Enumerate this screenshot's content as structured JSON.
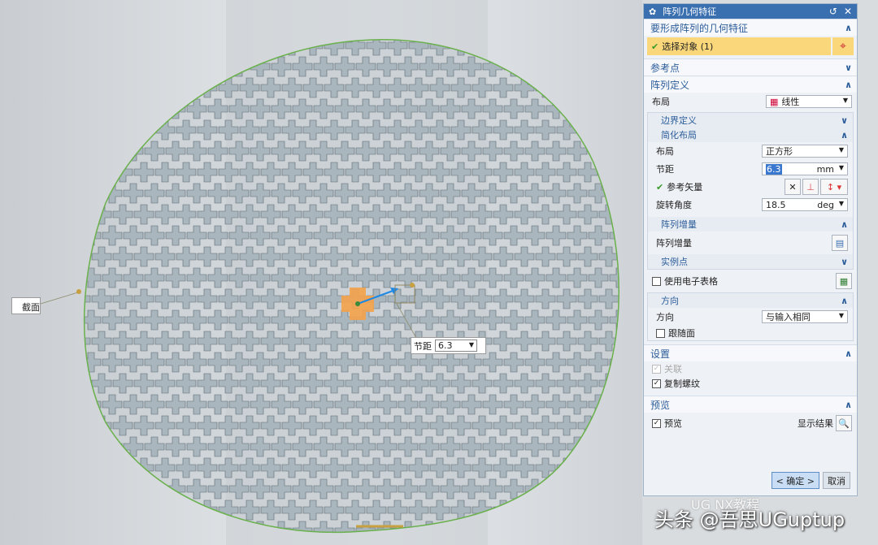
{
  "viewport": {
    "section_label": "截面",
    "pitch_label": "节距",
    "pitch_value": "6.3",
    "colors": {
      "pattern": "#a9b6bd",
      "boundary": "#6ab04c",
      "seed": "#f5a24a",
      "vector": "#1e88e5"
    }
  },
  "dialog": {
    "title": "阵列几何特征",
    "geometry_section": {
      "title": "要形成阵列的几何特征",
      "select_label": "选择对象 (1)"
    },
    "ref_point": {
      "title": "参考点"
    },
    "pattern_def": {
      "title": "阵列定义",
      "layout_label": "布局",
      "layout_value": "线性",
      "boundary": {
        "title": "边界定义"
      },
      "simple": {
        "title": "简化布局",
        "layout_label": "布局",
        "layout_value": "正方形",
        "pitch_label": "节距",
        "pitch_value": "6.3",
        "pitch_unit": "mm",
        "ref_vector_label": "参考矢量",
        "rotation_label": "旋转角度",
        "rotation_value": "18.5",
        "rotation_unit": "deg"
      },
      "increment": {
        "title": "阵列增量",
        "label": "阵列增量"
      },
      "instance": {
        "title": "实例点"
      },
      "spreadsheet_label": "使用电子表格",
      "orientation": {
        "title": "方向",
        "label": "方向",
        "value": "与输入相同",
        "follow_face_label": "跟随面"
      }
    },
    "settings": {
      "title": "设置",
      "associative_label": "关联",
      "copy_threads_label": "复制螺纹"
    },
    "preview": {
      "title": "预览",
      "preview_label": "预览",
      "show_result_label": "显示结果"
    },
    "ok_label": "< 确定 >",
    "cancel_label": "取消"
  },
  "watermark": {
    "main": "头条 @吾思UGuptup",
    "small": "UG NX教程"
  }
}
